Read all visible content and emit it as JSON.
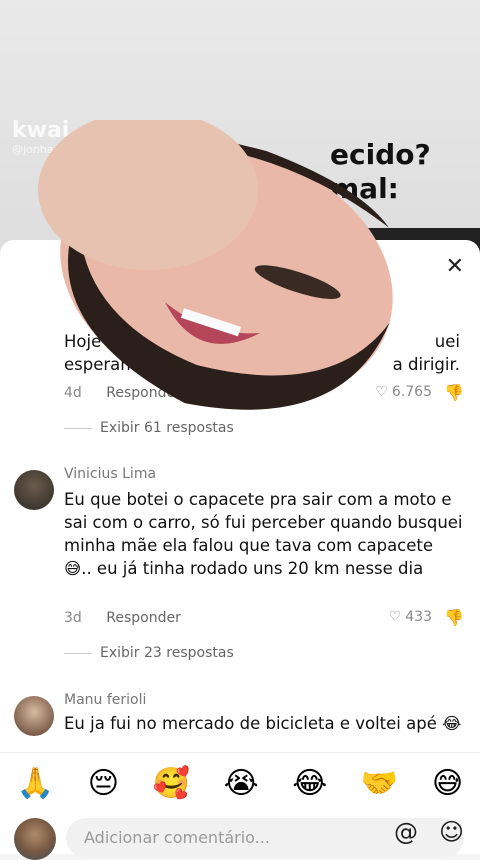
{
  "video": {
    "watermark": "kwai",
    "watermark_user": "@jonhan",
    "title_line1": "ecido?",
    "title_line2": "mal:"
  },
  "comments": [
    {
      "user": "",
      "text_line1": "Hoje",
      "text_tail1": "uei",
      "text_line2": "esperando kkkk",
      "text_tail2": "a dirigir.",
      "age": "4d",
      "reply": "Responder",
      "likes": "6.765",
      "view_replies": "Exibir 61 respostas"
    },
    {
      "user": "Vinicius Lima",
      "text": "Eu que botei o capacete pra sair com a moto e sai com o carro, só fui perceber quando busquei minha mãe ela falou que tava com capacete 😅.. eu já tinha rodado uns 20 km nesse dia",
      "age": "3d",
      "reply": "Responder",
      "likes": "433",
      "view_replies": "Exibir 23 respostas"
    },
    {
      "user": "Manu ferioli",
      "text": "Eu ja fui no mercado de bicicleta e voltei apé 😂"
    }
  ],
  "emoji_bar": [
    "🙏",
    "😔",
    "🥰",
    "😭",
    "😂",
    "🤝",
    "😅"
  ],
  "input": {
    "placeholder": "Adicionar comentário...",
    "at_symbol": "@",
    "emoji_symbol": "☺"
  },
  "icons": {
    "close": "close-icon",
    "heart": "heart-icon",
    "dislike": "dislike-icon"
  }
}
